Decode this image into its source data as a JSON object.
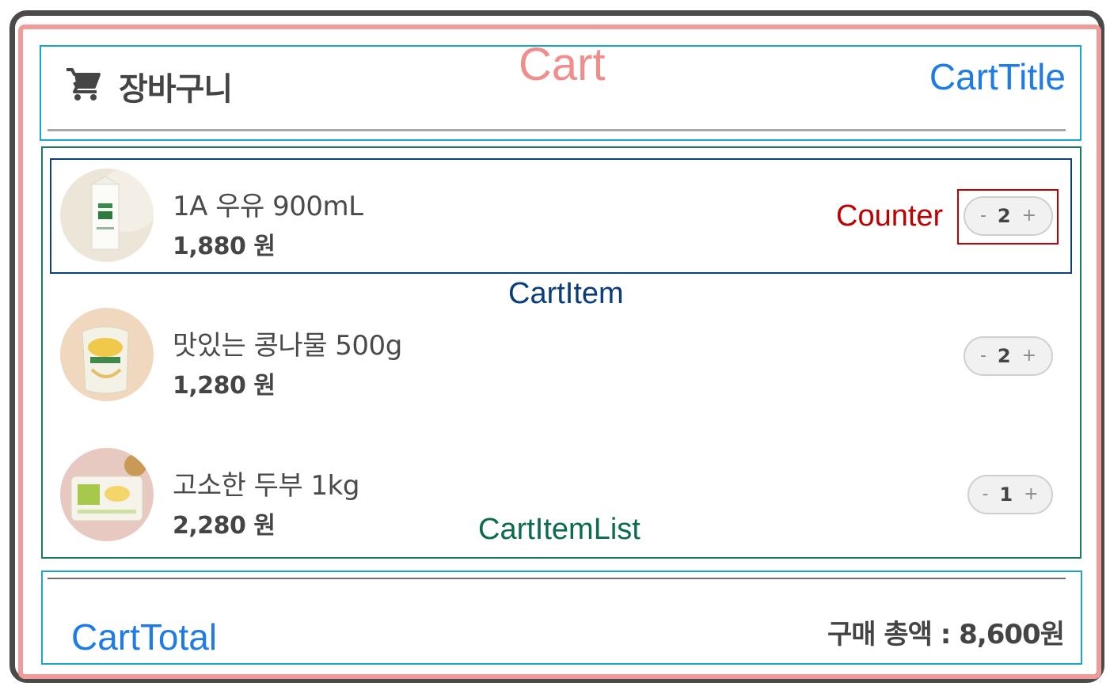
{
  "annotations": {
    "cart": "Cart",
    "cart_title": "CartTitle",
    "counter": "Counter",
    "cart_item": "CartItem",
    "cart_item_list": "CartItemList",
    "cart_total": "CartTotal"
  },
  "cart": {
    "title": "장바구니",
    "items": [
      {
        "name": "1A 우유 900mL",
        "price": "1,880 원",
        "quantity": "2",
        "minus": "-",
        "plus": "+"
      },
      {
        "name": "맛있는 콩나물 500g",
        "price": "1,280 원",
        "quantity": "2",
        "minus": "-",
        "plus": "+"
      },
      {
        "name": "고소한 두부 1kg",
        "price": "2,280 원",
        "quantity": "1",
        "minus": "-",
        "plus": "+"
      }
    ],
    "total_label": "구매 총액 : 8,600원"
  },
  "colors": {
    "cart": "#f09a9a",
    "cart_title": "#1aa6cc",
    "cart_item_list": "#1a7a5e",
    "cart_item": "#0d3f7a",
    "counter": "#c00000",
    "cart_total": "#1aa6cc"
  }
}
